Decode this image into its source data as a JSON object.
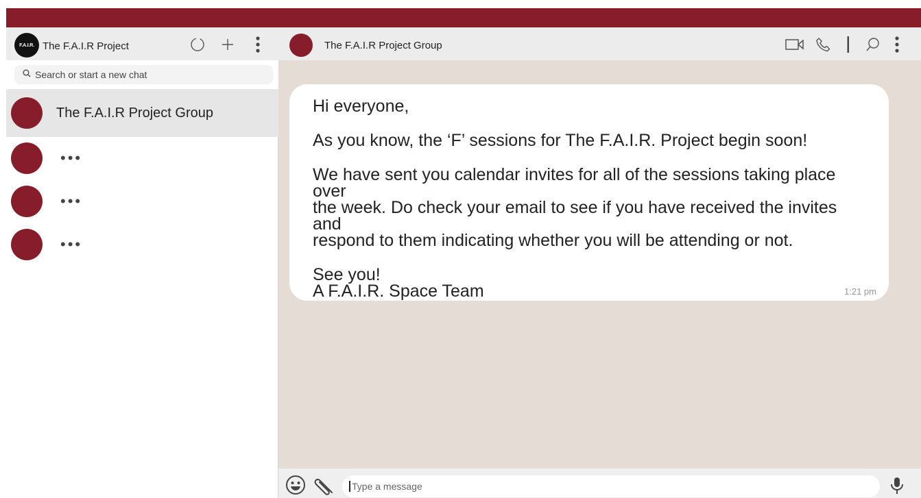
{
  "colors": {
    "brand": "#871c2a",
    "chat_bg": "#e5ddd5",
    "header_bg": "#ececec"
  },
  "sidebar": {
    "logo_text": "F.A.I.R.",
    "title": "The F.A.I.R Project",
    "icons": [
      "status-icon",
      "plus-icon",
      "kebab-menu-icon"
    ],
    "search": {
      "placeholder": "Search or start a new chat"
    },
    "chats": [
      {
        "name": "The F.A.I.R Project Group",
        "active": true
      },
      {
        "name": "•••"
      },
      {
        "name": "•••"
      },
      {
        "name": "•••"
      }
    ]
  },
  "chat": {
    "title": "The F.A.I.R Project Group",
    "header_icons": [
      "video-call-icon",
      "phone-icon",
      "search-icon",
      "kebab-menu-icon"
    ],
    "message": {
      "greeting": "Hi everyone,",
      "para1": "As you know, the ‘F’ sessions for The F.A.I.R. Project begin soon!",
      "para2_line1": "We have sent you calendar invites for all of the sessions taking place over",
      "para2_line2": "the week. Do check your email to see if you have received the invites and",
      "para2_line3": "respond to them indicating whether you will be attending or not.",
      "sign_line1": "See you!",
      "sign_line2": "A F.A.I.R. Space Team",
      "time": "1:21 pm"
    },
    "composer": {
      "placeholder": "Type a message",
      "icons": [
        "emoji-icon",
        "attachment-icon",
        "microphone-icon"
      ]
    }
  }
}
